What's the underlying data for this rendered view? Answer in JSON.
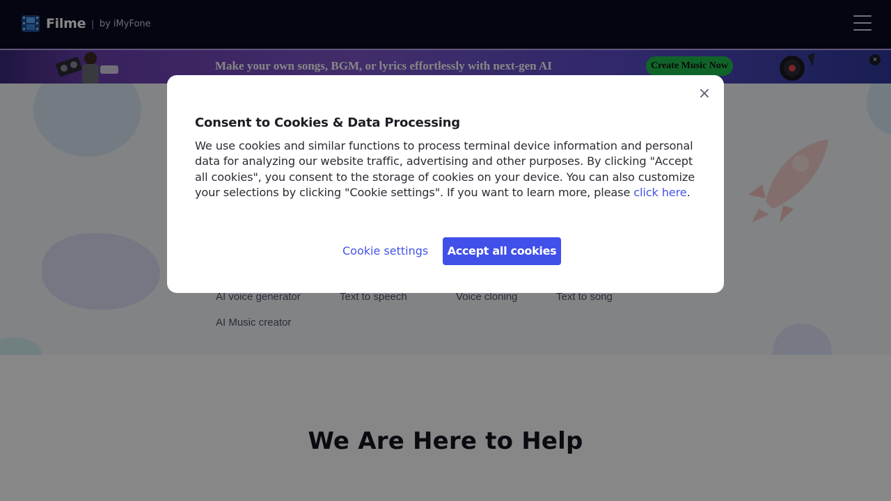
{
  "header": {
    "brand": "Filme",
    "separator": "|",
    "by": "by iMyFone",
    "icons": {
      "logo": "film-logo-icon",
      "menu": "hamburger-menu-icon"
    }
  },
  "banner": {
    "text": "Make your own songs, BGM, or lyrics effortlessly with next-gen AI",
    "cta": "Create Music Now",
    "close": "×",
    "colors": {
      "cta": "#1fbd4e",
      "background": "#6b3fb0"
    }
  },
  "hero": {
    "links": [
      "AI voice generator",
      "Text to speech",
      "Voice cloning",
      "Text to song",
      "AI Music creator"
    ]
  },
  "help": {
    "title": "We Are Here to Help"
  },
  "cookie_modal": {
    "title": "Consent to Cookies & Data Processing",
    "body": "We use cookies and similar functions to process terminal device information and personal data for analyzing our website traffic, advertising and other purposes. By clicking \"Accept all cookies\", you consent to the storage of cookies on your device. You can also customize your selections by clicking \"Cookie settings\". If you want to learn more, please ",
    "link_text": "click here",
    "link_suffix": ".",
    "close": "×",
    "settings_label": "Cookie settings",
    "accept_label": "Accept all cookies",
    "colors": {
      "accent": "#4050e8",
      "link": "#4353e6"
    }
  }
}
